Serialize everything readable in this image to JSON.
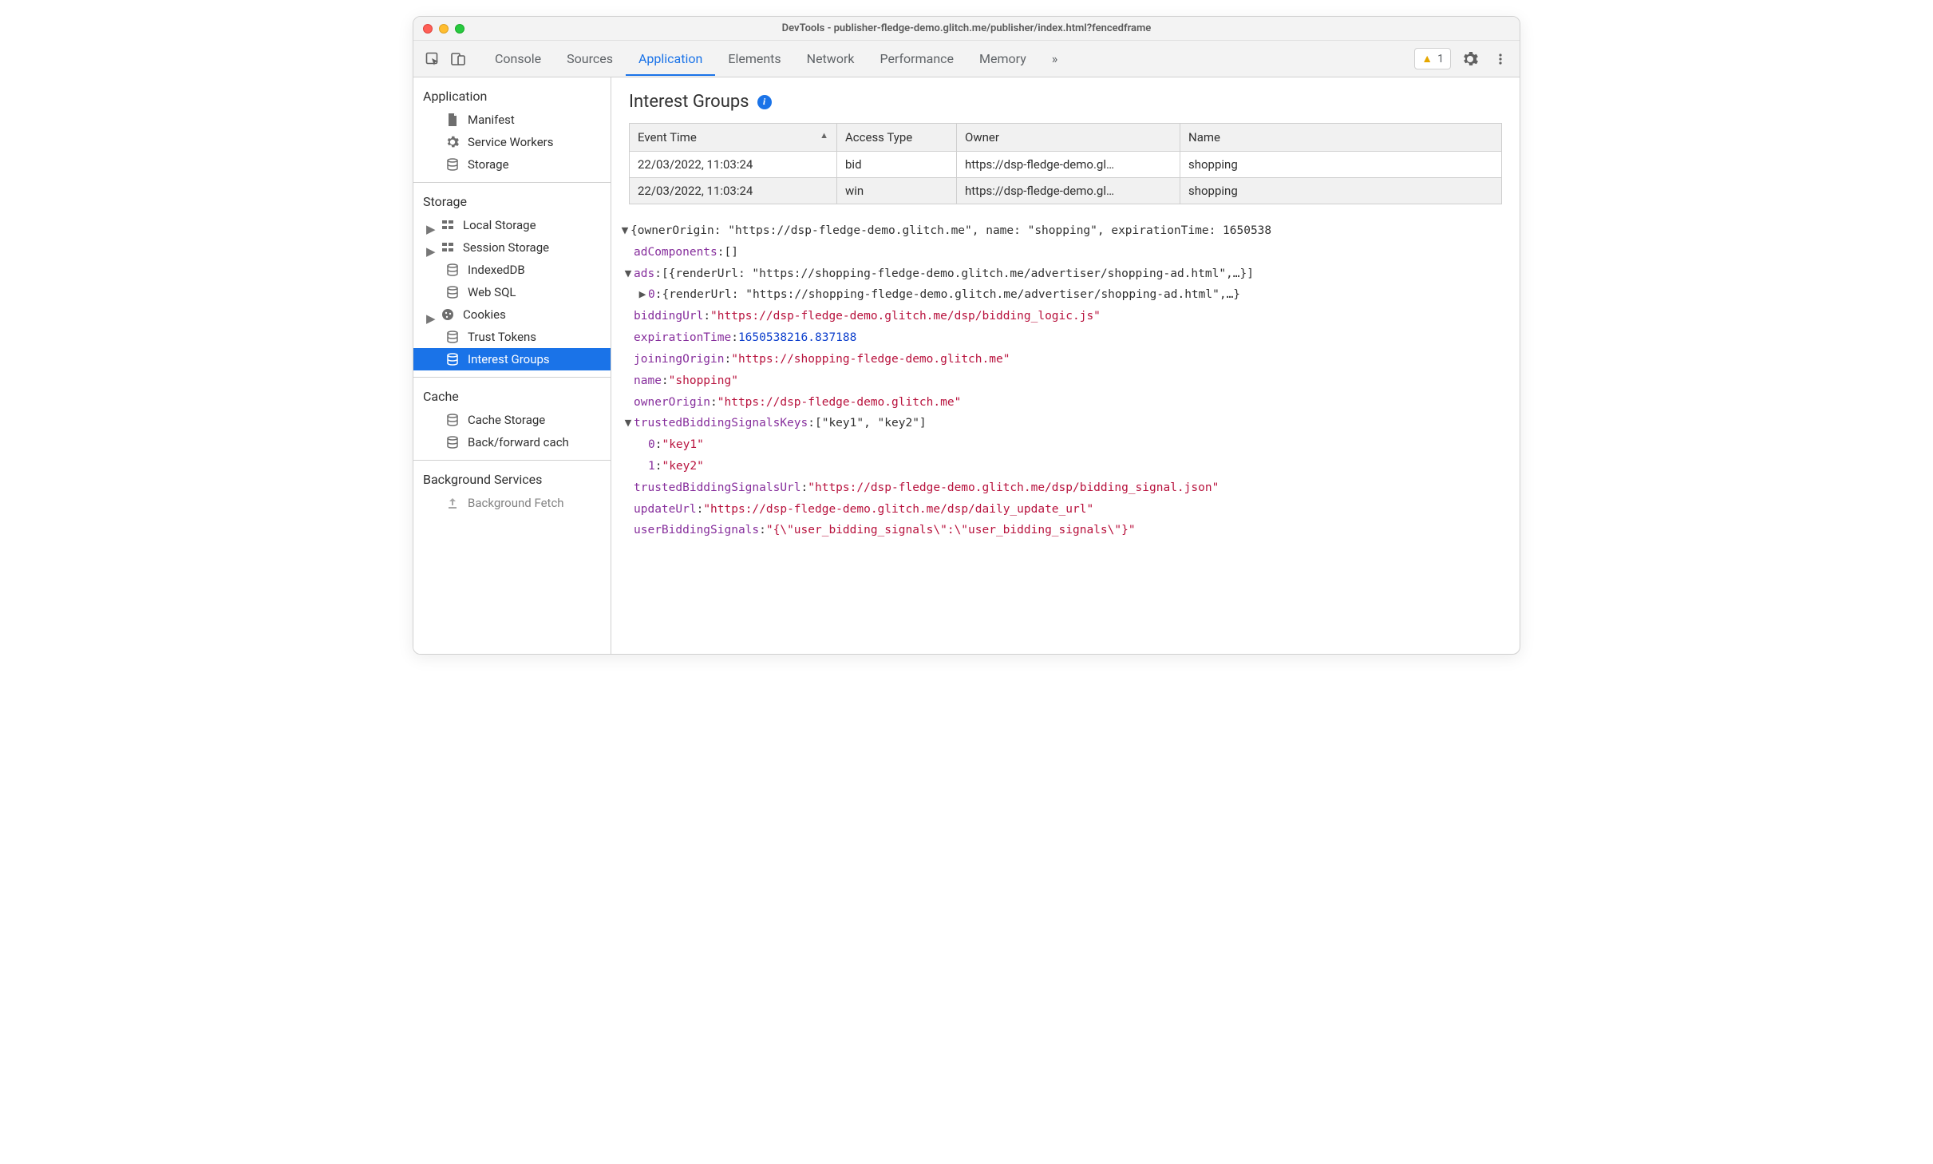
{
  "window": {
    "title": "DevTools - publisher-fledge-demo.glitch.me/publisher/index.html?fencedframe"
  },
  "tabs": [
    "Console",
    "Sources",
    "Application",
    "Elements",
    "Network",
    "Performance",
    "Memory"
  ],
  "activeTab": "Application",
  "issues_count": "1",
  "sidebar": {
    "application": {
      "heading": "Application",
      "items": [
        "Manifest",
        "Service Workers",
        "Storage"
      ]
    },
    "storage": {
      "heading": "Storage",
      "items": [
        "Local Storage",
        "Session Storage",
        "IndexedDB",
        "Web SQL",
        "Cookies",
        "Trust Tokens",
        "Interest Groups"
      ]
    },
    "cache": {
      "heading": "Cache",
      "items": [
        "Cache Storage",
        "Back/forward cach"
      ]
    },
    "bg": {
      "heading": "Background Services",
      "items": [
        "Background Fetch"
      ]
    }
  },
  "panel": {
    "title": "Interest Groups"
  },
  "table": {
    "headers": [
      "Event Time",
      "Access Type",
      "Owner",
      "Name"
    ],
    "rows": [
      {
        "time": "22/03/2022, 11:03:24",
        "type": "bid",
        "owner": "https://dsp-fledge-demo.gl…",
        "name": "shopping"
      },
      {
        "time": "22/03/2022, 11:03:24",
        "type": "win",
        "owner": "https://dsp-fledge-demo.gl…",
        "name": "shopping"
      }
    ]
  },
  "detail": {
    "header": "{ownerOrigin: \"https://dsp-fledge-demo.glitch.me\", name: \"shopping\", expirationTime: 1650538",
    "adComponents_k": "adComponents",
    "adComponents_v": "[]",
    "ads_k": "ads",
    "ads_v": "[{renderUrl: \"https://shopping-fledge-demo.glitch.me/advertiser/shopping-ad.html\",…}]",
    "ads_0_k": "0",
    "ads_0_v": "{renderUrl: \"https://shopping-fledge-demo.glitch.me/advertiser/shopping-ad.html\",…}",
    "biddingUrl_k": "biddingUrl",
    "biddingUrl_v": "\"https://dsp-fledge-demo.glitch.me/dsp/bidding_logic.js\"",
    "expirationTime_k": "expirationTime",
    "expirationTime_v": "1650538216.837188",
    "joiningOrigin_k": "joiningOrigin",
    "joiningOrigin_v": "\"https://shopping-fledge-demo.glitch.me\"",
    "name_k": "name",
    "name_v": "\"shopping\"",
    "ownerOrigin_k": "ownerOrigin",
    "ownerOrigin_v": "\"https://dsp-fledge-demo.glitch.me\"",
    "tbsk_k": "trustedBiddingSignalsKeys",
    "tbsk_v": "[\"key1\", \"key2\"]",
    "tbsk_0_k": "0",
    "tbsk_0_v": "\"key1\"",
    "tbsk_1_k": "1",
    "tbsk_1_v": "\"key2\"",
    "tbsu_k": "trustedBiddingSignalsUrl",
    "tbsu_v": "\"https://dsp-fledge-demo.glitch.me/dsp/bidding_signal.json\"",
    "updateUrl_k": "updateUrl",
    "updateUrl_v": "\"https://dsp-fledge-demo.glitch.me/dsp/daily_update_url\"",
    "ubs_k": "userBiddingSignals",
    "ubs_v": "\"{\\\"user_bidding_signals\\\":\\\"user_bidding_signals\\\"}\""
  }
}
